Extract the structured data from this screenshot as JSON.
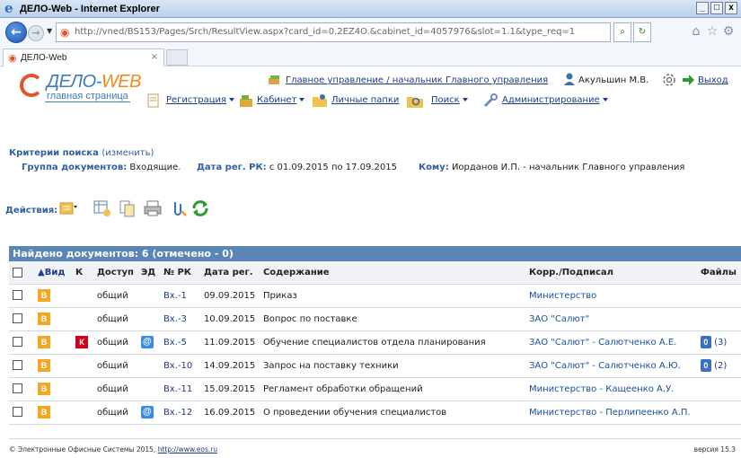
{
  "window": {
    "title": "ДЕЛО-Web - Internet Explorer",
    "min_label": "_",
    "max_label": "□",
    "close_label": "x"
  },
  "browser": {
    "url_host": "http://vned",
    "url_path": "/BS153/Pages/Srch/ResultView.aspx?card_id=0.2EZ4O.&cabinet_id=4057976&slot=1.1&type_req=1",
    "tab_title": "ДЕЛО-Web",
    "tab_close": "×"
  },
  "header": {
    "logo_main": "ДЕЛО-",
    "logo_web": "WEB",
    "logo_sub": "главная страница",
    "department_link": "Главное управление / начальник Главного управления",
    "user_name": "Акульшин М.В.",
    "logout": "Выход"
  },
  "menu": {
    "registration": "Регистрация",
    "cabinet": "Кабинет",
    "personal_folders": "Личные папки",
    "search": "Поиск",
    "administration": "Администрирование"
  },
  "criteria": {
    "title": "Критерии поиска",
    "change": "(изменить)",
    "group_label": "Группа документов:",
    "group_value": "Входящие.",
    "date_label": "Дата рег. РК:",
    "date_value": "с 01.09.2015 по 17.09.2015",
    "to_label": "Кому:",
    "to_value": "Иорданов И.П. - начальник Главного управления"
  },
  "actions": {
    "label": "Действия:"
  },
  "results": {
    "found_text": "Найдено документов: 6 (отмечено - 0)",
    "columns": {
      "view": "▲Вид",
      "k": "К",
      "access": "Доступ",
      "ed": "ЭД",
      "num": "№ РК",
      "date": "Дата рег.",
      "content": "Содержание",
      "corr": "Корр./Подписал",
      "files": "Файлы"
    },
    "rows": [
      {
        "view": "В",
        "k": "",
        "access": "общий",
        "ed": "",
        "num": "Вх.-1",
        "date": "09.09.2015",
        "content": "Приказ",
        "corr": "Министерство",
        "files": ""
      },
      {
        "view": "В",
        "k": "",
        "access": "общий",
        "ed": "",
        "num": "Вх.-3",
        "date": "10.09.2015",
        "content": "Вопрос по поставке",
        "corr": "ЗАО \"Салют\"",
        "files": ""
      },
      {
        "view": "В",
        "k": "К",
        "access": "общий",
        "ed": "@",
        "num": "Вх.-5",
        "date": "11.09.2015",
        "content": "Обучение специалистов отдела планирования",
        "corr": "ЗАО \"Салют\" - Салютченко А.Е.",
        "files": "(3)"
      },
      {
        "view": "В",
        "k": "",
        "access": "общий",
        "ed": "",
        "num": "Вх.-10",
        "date": "14.09.2015",
        "content": "Запрос на поставку техники",
        "corr": "ЗАО \"Салют\" - Салютченко А.Ю.",
        "files": "(2)"
      },
      {
        "view": "В",
        "k": "",
        "access": "общий",
        "ed": "",
        "num": "Вх.-11",
        "date": "15.09.2015",
        "content": "Регламент обработки обращений",
        "corr": "Министерство - Кащеенко А.У.",
        "files": ""
      },
      {
        "view": "В",
        "k": "",
        "access": "общий",
        "ed": "@",
        "num": "Вх.-12",
        "date": "16.09.2015",
        "content": "О проведении обучения специалистов",
        "corr": "Министерство - Перлипеенко А.П.",
        "files": ""
      }
    ]
  },
  "footer": {
    "copyright": "© Электронные Офисные Системы 2015,",
    "link": "http://www.eos.ru",
    "version": "версия 15.3"
  }
}
